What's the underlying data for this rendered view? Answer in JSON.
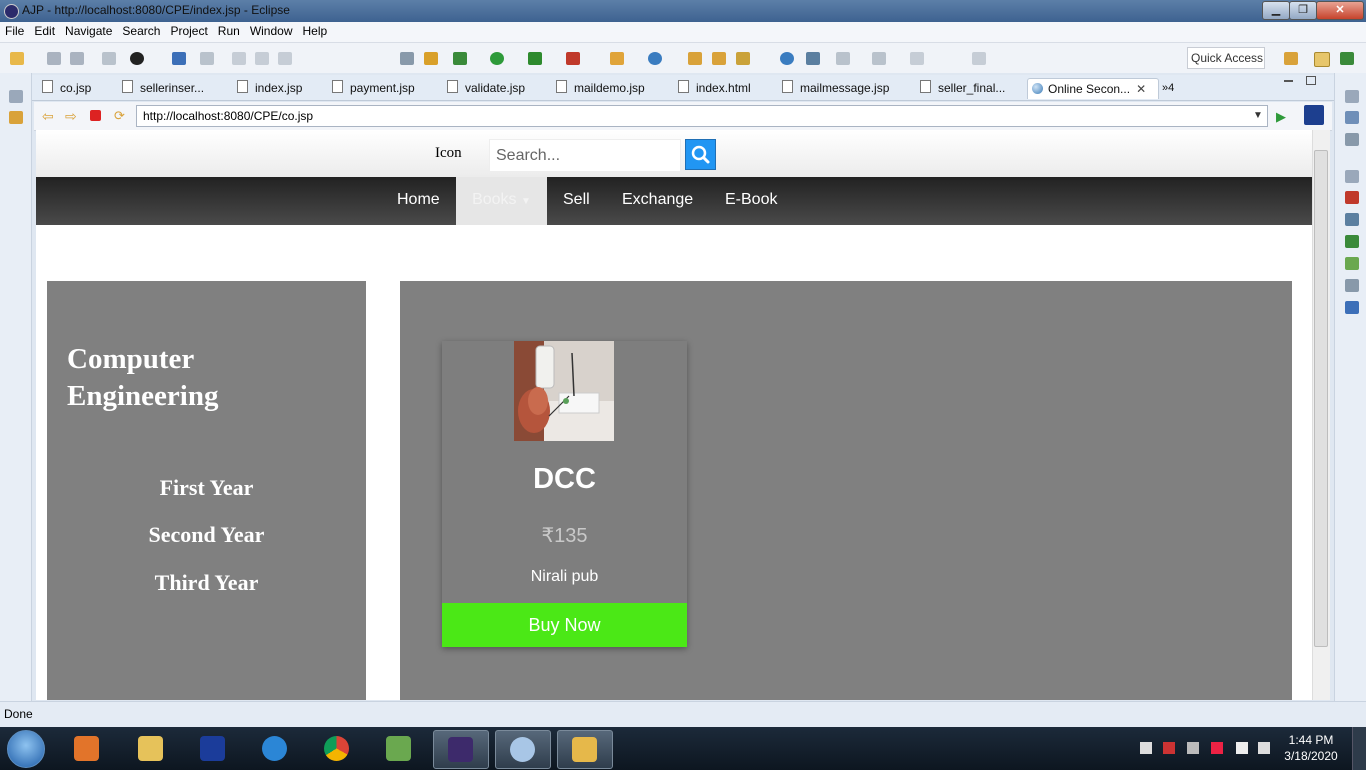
{
  "window": {
    "title": "AJP - http://localhost:8080/CPE/index.jsp - Eclipse"
  },
  "menu": [
    "File",
    "Edit",
    "Navigate",
    "Search",
    "Project",
    "Run",
    "Window",
    "Help"
  ],
  "quick_access": "Quick Access",
  "tabs": [
    "co.jsp",
    "sellerinser...",
    "index.jsp",
    "payment.jsp",
    "validate.jsp",
    "maildemo.jsp",
    "index.html",
    "mailmessage.jsp",
    "seller_final...",
    "Online Secon..."
  ],
  "tabs_overflow": "»4",
  "browser": {
    "url": "http://localhost:8080/CPE/co.jsp"
  },
  "site": {
    "icon_label": "Icon",
    "search_placeholder": "Search...",
    "nav": [
      "Home",
      "Books",
      "Sell",
      "Exchange",
      "E-Book"
    ],
    "sidebar": {
      "heading_line1": "Computer",
      "heading_line2": "Engineering",
      "years": [
        "First Year",
        "Second Year",
        "Third Year"
      ]
    },
    "product": {
      "title": "DCC",
      "price": "₹135",
      "publisher": "Nirali pub",
      "button": "Buy Now"
    }
  },
  "status": "Done",
  "clock": {
    "time": "1:44 PM",
    "date": "3/18/2020"
  },
  "colors": {
    "buy_button": "#4be816",
    "panel": "#808080",
    "search_button": "#2196F3"
  }
}
